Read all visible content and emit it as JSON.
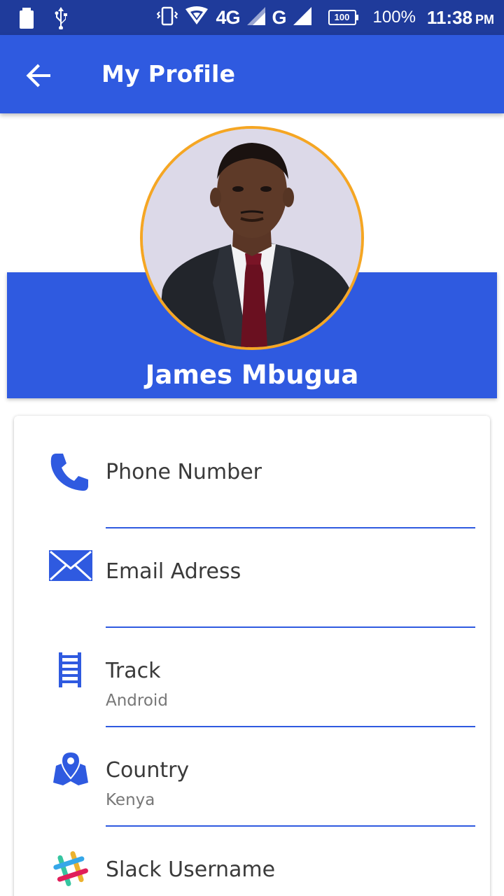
{
  "status_bar": {
    "network_4g": "4G",
    "network_g": "G",
    "battery_level": "100",
    "battery_percent": "100%",
    "time": "11:38",
    "ampm": "PM"
  },
  "app_bar": {
    "title": "My Profile",
    "back_icon": "arrow-back-icon"
  },
  "profile": {
    "name": "James Mbugua",
    "avatar_icon": "profile-photo",
    "avatar_border_color": "#f5a623"
  },
  "fields": [
    {
      "label": "Phone Number",
      "value": "",
      "icon": "phone-icon"
    },
    {
      "label": "Email Adress",
      "value": "",
      "icon": "email-icon"
    },
    {
      "label": "Track",
      "value": "Android",
      "icon": "track-icon"
    },
    {
      "label": "Country",
      "value": "Kenya",
      "icon": "map-pin-icon"
    },
    {
      "label": "Slack Username",
      "value": "",
      "icon": "slack-icon"
    }
  ],
  "colors": {
    "primary": "#2f5ae0",
    "status_bar": "#1f3b9b",
    "accent": "#f5a623"
  }
}
